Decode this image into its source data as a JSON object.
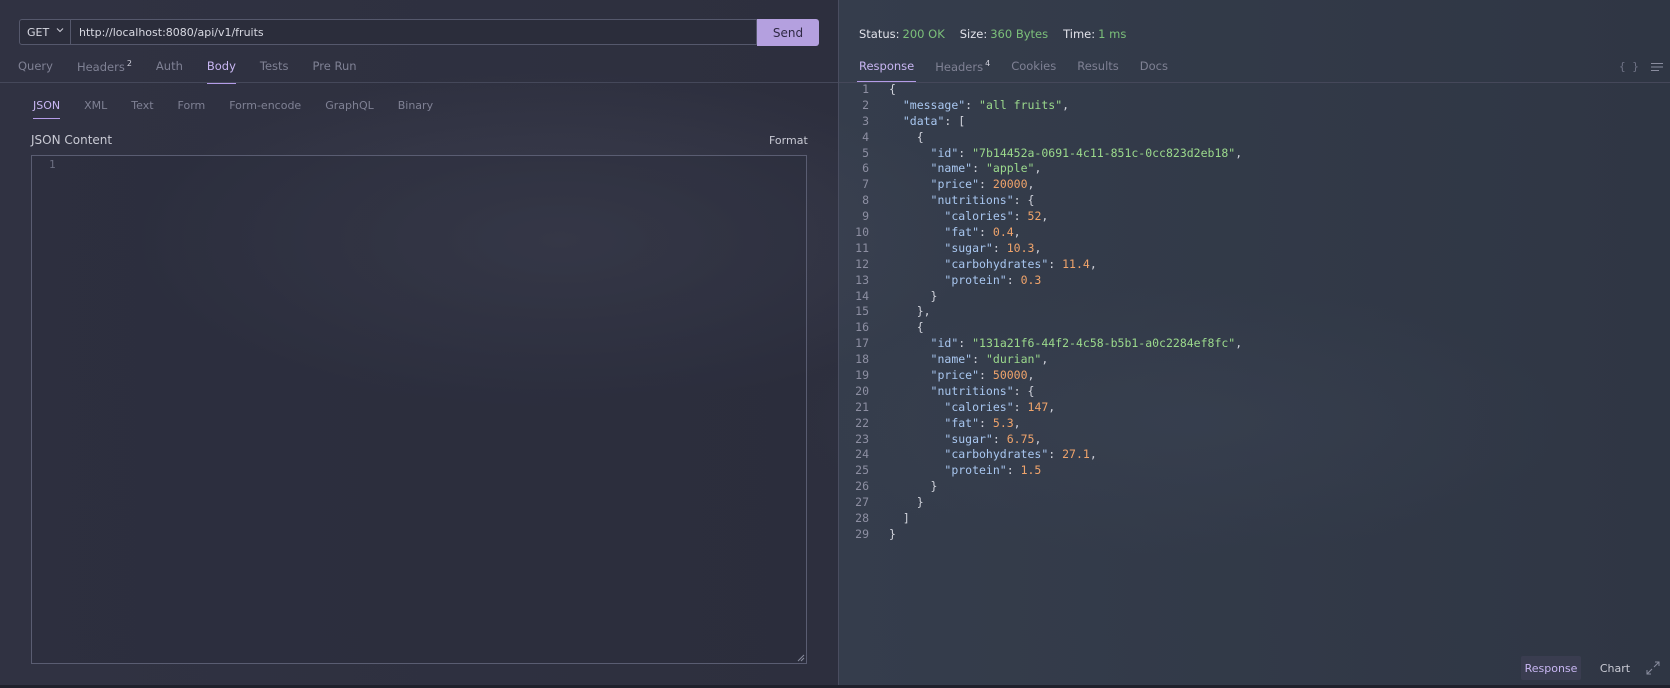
{
  "request": {
    "method": "GET",
    "url": "http://localhost:8080/api/v1/fruits",
    "send_label": "Send",
    "tabs": [
      {
        "label": "Query",
        "badge": ""
      },
      {
        "label": "Headers",
        "badge": "2"
      },
      {
        "label": "Auth",
        "badge": ""
      },
      {
        "label": "Body",
        "badge": "",
        "active": true
      },
      {
        "label": "Tests",
        "badge": ""
      },
      {
        "label": "Pre Run",
        "badge": ""
      }
    ],
    "body_types": [
      "JSON",
      "XML",
      "Text",
      "Form",
      "Form-encode",
      "GraphQL",
      "Binary"
    ],
    "body_active": "JSON",
    "json_label": "JSON Content",
    "format_label": "Format",
    "editor_line": "1"
  },
  "response": {
    "status_label": "Status:",
    "status_value": "200 OK",
    "size_label": "Size:",
    "size_value": "360 Bytes",
    "time_label": "Time:",
    "time_value": "1 ms",
    "tabs": [
      {
        "label": "Response",
        "badge": "",
        "active": true
      },
      {
        "label": "Headers",
        "badge": "4"
      },
      {
        "label": "Cookies",
        "badge": ""
      },
      {
        "label": "Results",
        "badge": ""
      },
      {
        "label": "Docs",
        "badge": ""
      }
    ],
    "braces_icon": "{ }",
    "bottom_buttons": [
      "Response",
      "Chart"
    ],
    "code_lines": [
      "{",
      "  \"message\": \"all fruits\",",
      "  \"data\": [",
      "    {",
      "      \"id\": \"7b14452a-0691-4c11-851c-0cc823d2eb18\",",
      "      \"name\": \"apple\",",
      "      \"price\": 20000,",
      "      \"nutritions\": {",
      "        \"calories\": 52,",
      "        \"fat\": 0.4,",
      "        \"sugar\": 10.3,",
      "        \"carbohydrates\": 11.4,",
      "        \"protein\": 0.3",
      "      }",
      "    },",
      "    {",
      "      \"id\": \"131a21f6-44f2-4c58-b5b1-a0c2284ef8fc\",",
      "      \"name\": \"durian\",",
      "      \"price\": 50000,",
      "      \"nutritions\": {",
      "        \"calories\": 147,",
      "        \"fat\": 5.3,",
      "        \"sugar\": 6.75,",
      "        \"carbohydrates\": 27.1,",
      "        \"protein\": 1.5",
      "      }",
      "    }",
      "  ]",
      "}"
    ]
  }
}
